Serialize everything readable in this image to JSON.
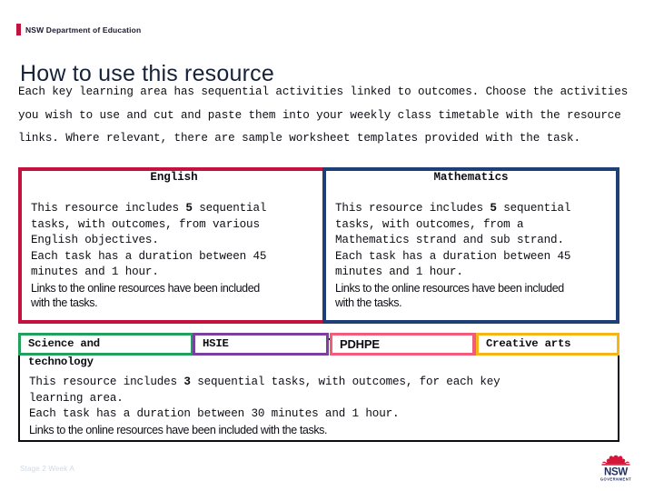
{
  "brand": {
    "text": "NSW Department of Education",
    "tick_color": "#C4123F"
  },
  "page_title": "How to use this resource",
  "intro": {
    "paragraph": "Each key learning area has sequential activities linked to outcomes. Choose the activities you wish to use and cut and paste them into your weekly class timetable with the resource links. Where relevant, there are sample worksheet templates provided with the task."
  },
  "panels": [
    {
      "id": "english",
      "heading": "English",
      "border_color": "#C4123F",
      "lines": [
        {
          "style": "mono",
          "pre": "This resource includes ",
          "bold": "5",
          "post": " sequential"
        },
        {
          "style": "mono",
          "text": "tasks, with outcomes, from various"
        },
        {
          "style": "mono",
          "text": "English objectives."
        },
        {
          "style": "mono",
          "text": "Each task has a duration between 45"
        },
        {
          "style": "mono",
          "text": "minutes and 1 hour."
        },
        {
          "style": "sans",
          "text": "Links to the online resources have been included"
        },
        {
          "style": "sans",
          "text": "with the tasks."
        }
      ]
    },
    {
      "id": "mathematics",
      "heading": "Mathematics",
      "border_color": "#1F4076",
      "accent_color": "#C4123F",
      "lines": [
        {
          "style": "mono",
          "pre": "This resource includes ",
          "bold": "5",
          "post": " sequential"
        },
        {
          "style": "mono",
          "text": "tasks, with outcomes, from a"
        },
        {
          "style": "mono",
          "text": "Mathematics strand and sub strand."
        },
        {
          "style": "mono",
          "text": "Each task has a duration between 45"
        },
        {
          "style": "mono",
          "text": "minutes and 1 hour."
        },
        {
          "style": "sans",
          "text": "Links to the online resources have been included"
        },
        {
          "style": "sans",
          "text": "with the tasks."
        }
      ]
    }
  ],
  "tabs": [
    {
      "id": "science",
      "label": "Science and",
      "overflow": "technology",
      "font": "mono",
      "border_color": "#22A05C"
    },
    {
      "id": "hsie",
      "label": "HSIE",
      "overflow": "",
      "font": "mono",
      "border_color": "#7B3FA0"
    },
    {
      "id": "pdhpe",
      "label": "PDHPE",
      "overflow": "",
      "font": "sans",
      "border_color": "#F25C7A"
    },
    {
      "id": "creative",
      "label": "Creative arts",
      "overflow": "",
      "font": "mono",
      "border_color": "#F5B519"
    }
  ],
  "lower_content": {
    "lines": [
      {
        "style": "mono",
        "pre": "This resource includes ",
        "bold": "3",
        "post": " sequential tasks, with outcomes, for each key"
      },
      {
        "style": "mono",
        "text": "learning area."
      },
      {
        "style": "mono",
        "text": "Each task has a duration between 30 minutes and 1 hour."
      },
      {
        "style": "sans",
        "text": "Links to the online resources have been included with the tasks."
      }
    ]
  },
  "footer": {
    "stage_label": "Stage 2 Week A",
    "logo": {
      "wordmark": "NSW",
      "sub_wordmark": "GOVERNMENT",
      "flower_color": "#D7153A",
      "text_color": "#1F2E5E"
    }
  }
}
